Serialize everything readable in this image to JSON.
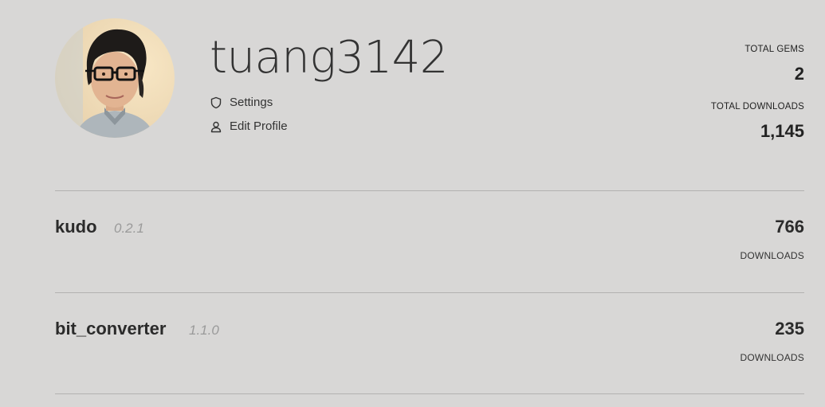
{
  "profile": {
    "username": "tuang3142",
    "settings_label": "Settings",
    "edit_profile_label": "Edit Profile"
  },
  "stats": {
    "total_gems_label": "TOTAL GEMS",
    "total_gems_value": "2",
    "total_downloads_label": "TOTAL DOWNLOADS",
    "total_downloads_value": "1,145"
  },
  "gems": [
    {
      "name": "kudo",
      "version": "0.2.1",
      "downloads": "766",
      "downloads_label": "DOWNLOADS"
    },
    {
      "name": "bit_converter",
      "version": "1.1.0",
      "downloads": "235",
      "downloads_label": "DOWNLOADS"
    }
  ],
  "icons": {
    "settings": "shield-icon",
    "edit_profile": "user-icon"
  },
  "colors": {
    "background": "#d8d7d6",
    "text": "#2a2a2a",
    "version_text": "#9a9a9a",
    "divider": "#b2b1b0"
  }
}
